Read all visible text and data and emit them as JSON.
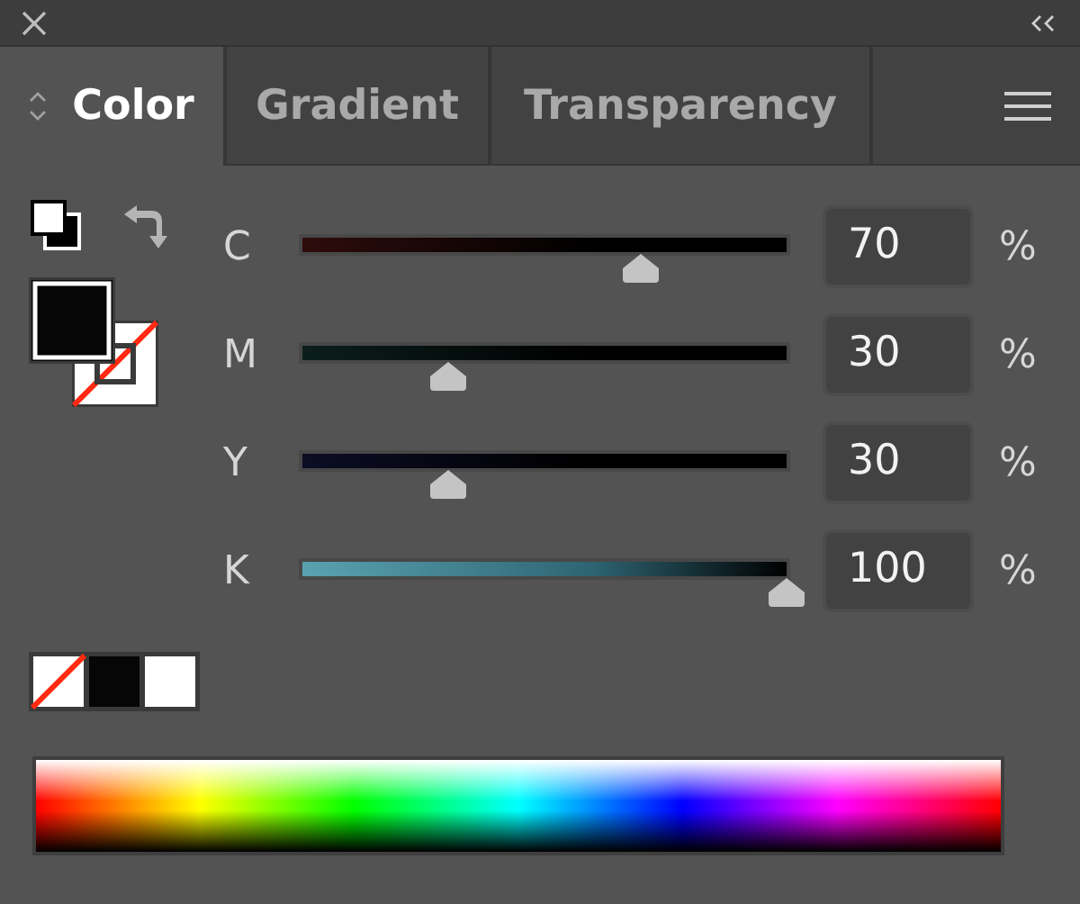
{
  "tabs": [
    {
      "label": "Color",
      "selected": true
    },
    {
      "label": "Gradient",
      "selected": false
    },
    {
      "label": "Transparency",
      "selected": false
    }
  ],
  "fill_stroke": {
    "fill": {
      "kind": "black"
    },
    "stroke": {
      "kind": "none"
    }
  },
  "channels": [
    {
      "name": "C",
      "level": 0.7,
      "value": "70",
      "unit": "%"
    },
    {
      "name": "M",
      "level": 0.3,
      "value": "30",
      "unit": "%"
    },
    {
      "name": "Y",
      "level": 0.3,
      "value": "30",
      "unit": "%"
    },
    {
      "name": "K",
      "level": 1.0,
      "value": "100",
      "unit": "%"
    }
  ],
  "quick_swatches": [
    {
      "kind": "none"
    },
    {
      "kind": "black"
    },
    {
      "kind": "white"
    }
  ]
}
